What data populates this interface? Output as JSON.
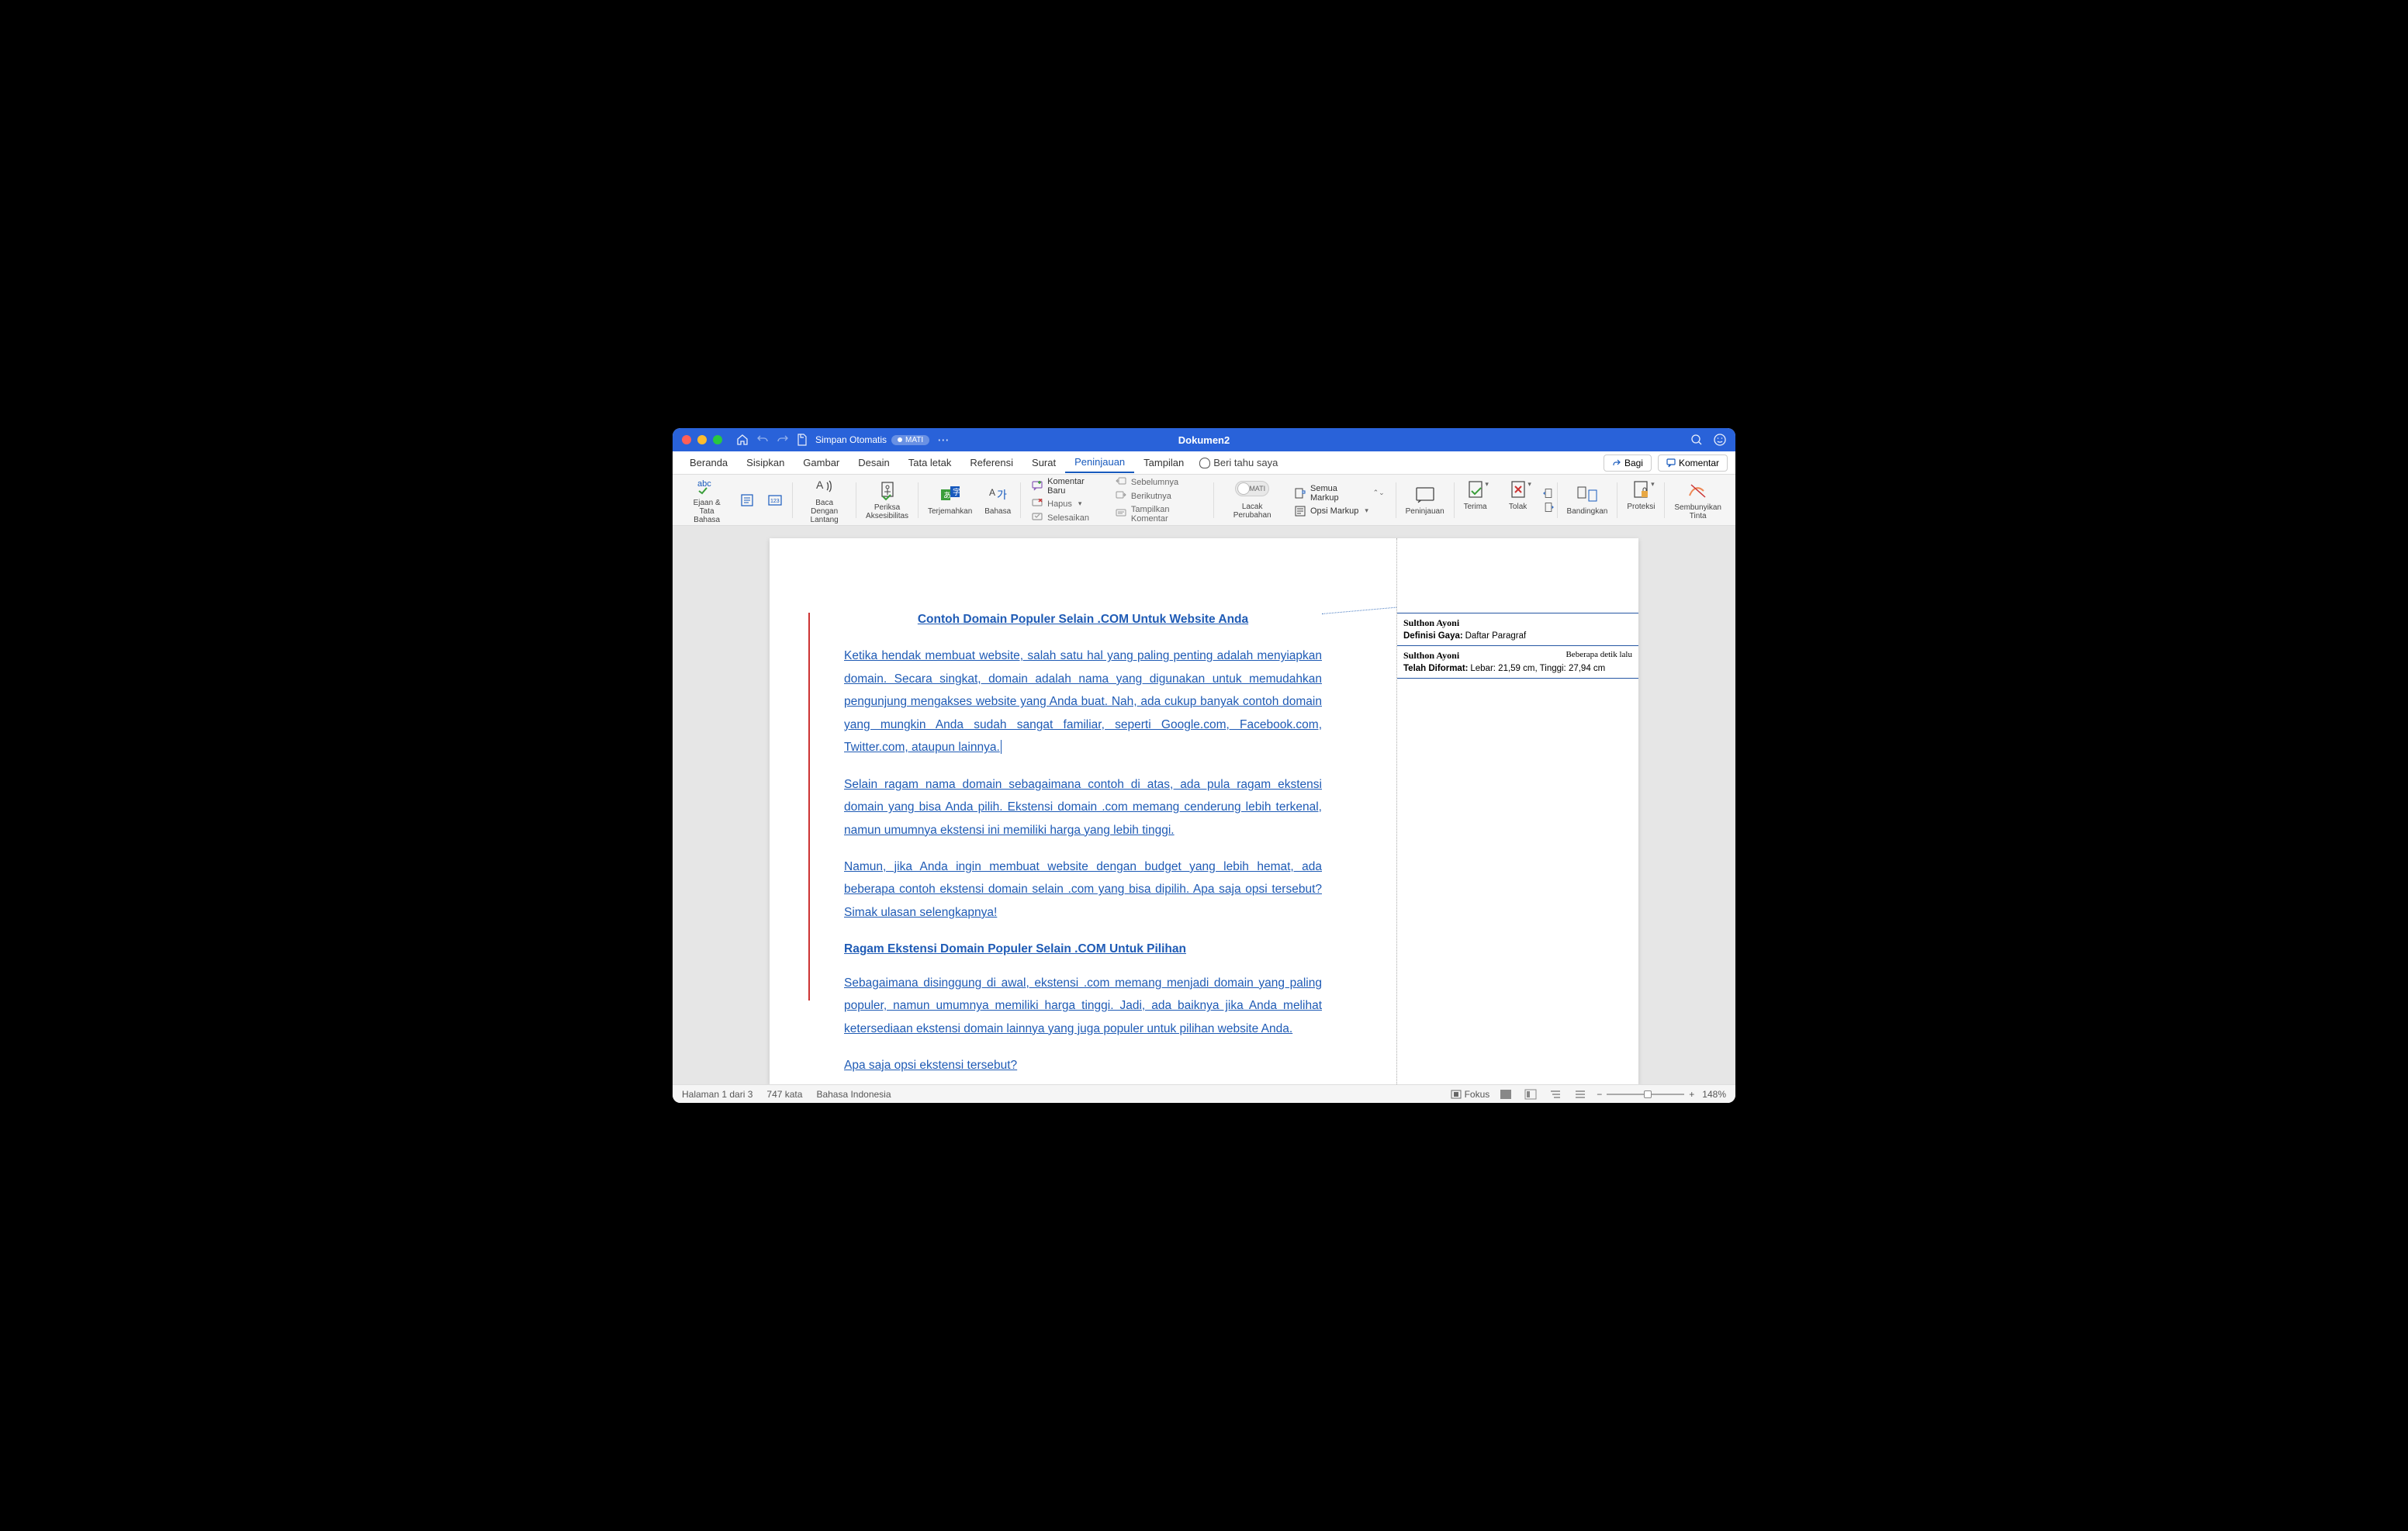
{
  "titlebar": {
    "autosave_label": "Simpan Otomatis",
    "autosave_state": "MATI",
    "doc_title": "Dokumen2"
  },
  "tabs": {
    "items": [
      "Beranda",
      "Sisipkan",
      "Gambar",
      "Desain",
      "Tata letak",
      "Referensi",
      "Surat",
      "Peninjauan",
      "Tampilan"
    ],
    "active_index": 7,
    "tell_me": "Beri tahu saya",
    "share": "Bagi",
    "comments": "Komentar"
  },
  "ribbon": {
    "spelling": "Ejaan &\nTata Bahasa",
    "readaloud": "Baca Dengan\nLantang",
    "accessibility": "Periksa\nAksesibilitas",
    "translate": "Terjemahkan",
    "language": "Bahasa",
    "new_comment": "Komentar Baru",
    "delete": "Hapus",
    "resolve": "Selesaikan",
    "previous": "Sebelumnya",
    "next": "Berikutnya",
    "show_comments": "Tampilkan Komentar",
    "toggle_off": "MATI",
    "track_changes": "Lacak Perubahan",
    "all_markup": "Semua Markup",
    "markup_options": "Opsi Markup",
    "reviewing": "Peninjauan",
    "accept": "Terima",
    "reject": "Tolak",
    "compare": "Bandingkan",
    "protect": "Proteksi",
    "hide_ink": "Sembunyikan\nTinta"
  },
  "document": {
    "title": "Contoh Domain Populer Selain .COM Untuk Website Anda",
    "p1": "Ketika hendak membuat website, salah satu hal yang paling penting adalah menyiapkan domain. Secara singkat, domain adalah nama yang digunakan untuk memudahkan pengunjung mengakses website yang Anda buat. Nah, ada cukup banyak contoh domain yang mungkin Anda sudah sangat familiar, seperti Google.com, Facebook.com, Twitter.com, ataupun lainnya.",
    "p2": "Selain ragam nama domain sebagaimana contoh di atas, ada pula ragam ekstensi domain yang bisa Anda pilih. Ekstensi domain .com memang cenderung lebih terkenal, namun umumnya ekstensi ini memiliki harga yang lebih tinggi.",
    "p3": "Namun, jika Anda ingin membuat website dengan budget yang lebih hemat, ada beberapa contoh ekstensi domain selain .com yang bisa dipilih. Apa saja opsi tersebut? Simak ulasan selengkapnya!",
    "h2": "Ragam Ekstensi Domain Populer Selain .COM Untuk Pilihan",
    "p4": "Sebagaimana disinggung di awal, ekstensi .com memang menjadi domain yang paling populer, namun umumnya memiliki harga tinggi. Jadi, ada baiknya jika Anda melihat ketersediaan ekstensi domain lainnya yang juga populer untuk pilihan website Anda.",
    "p5": "Apa saja opsi ekstensi tersebut?"
  },
  "markup": {
    "card1": {
      "author": "Sulthon Ayoni",
      "label": "Definisi Gaya:",
      "value": "Daftar Paragraf"
    },
    "card2": {
      "author": "Sulthon Ayoni",
      "time": "Beberapa detik lalu",
      "label": "Telah Diformat:",
      "value": "Lebar:  21,59 cm, Tinggi:  27,94 cm"
    }
  },
  "status": {
    "page": "Halaman 1 dari 3",
    "words": "747 kata",
    "language": "Bahasa Indonesia",
    "focus": "Fokus",
    "zoom": "148%"
  }
}
